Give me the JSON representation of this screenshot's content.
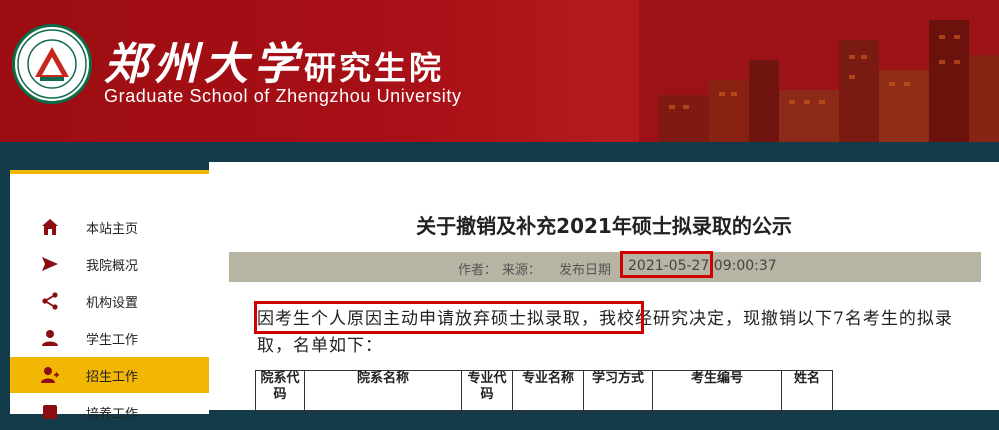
{
  "header": {
    "school_cn": "郑州大学",
    "school_cn_sub": "研究生院",
    "school_en": "Graduate School of Zhengzhou University",
    "logo_text": "ZHENGZHOU UNIVERSITY",
    "colors": {
      "primary": "#a80f16",
      "accent": "#f2b705",
      "logo_green": "#0f6a4a"
    }
  },
  "sidebar": {
    "items": [
      {
        "label": "本站主页",
        "icon": "home-icon"
      },
      {
        "label": "我院概况",
        "icon": "send-icon"
      },
      {
        "label": "机构设置",
        "icon": "share-icon"
      },
      {
        "label": "学生工作",
        "icon": "user-icon"
      },
      {
        "label": "招生工作",
        "icon": "user-add-icon",
        "active": true
      },
      {
        "label": "培养工作",
        "icon": "book-icon"
      }
    ]
  },
  "article": {
    "title": "关于撤销及补充2021年硕士拟录取的公示",
    "meta_author": "作者：",
    "meta_source": "来源：",
    "meta_date_label": "发布日期",
    "meta_date": "2021-05-27 09:00:37",
    "paragraph": "因考生个人原因主动申请放弃硕士拟录取，我校经研究决定，现撤销以下7名考生的拟录取，名单如下：",
    "table_headers": [
      "院系代码",
      "院系名称",
      "专业代码",
      "专业名称",
      "学习方式",
      "考生编号",
      "姓名"
    ]
  }
}
